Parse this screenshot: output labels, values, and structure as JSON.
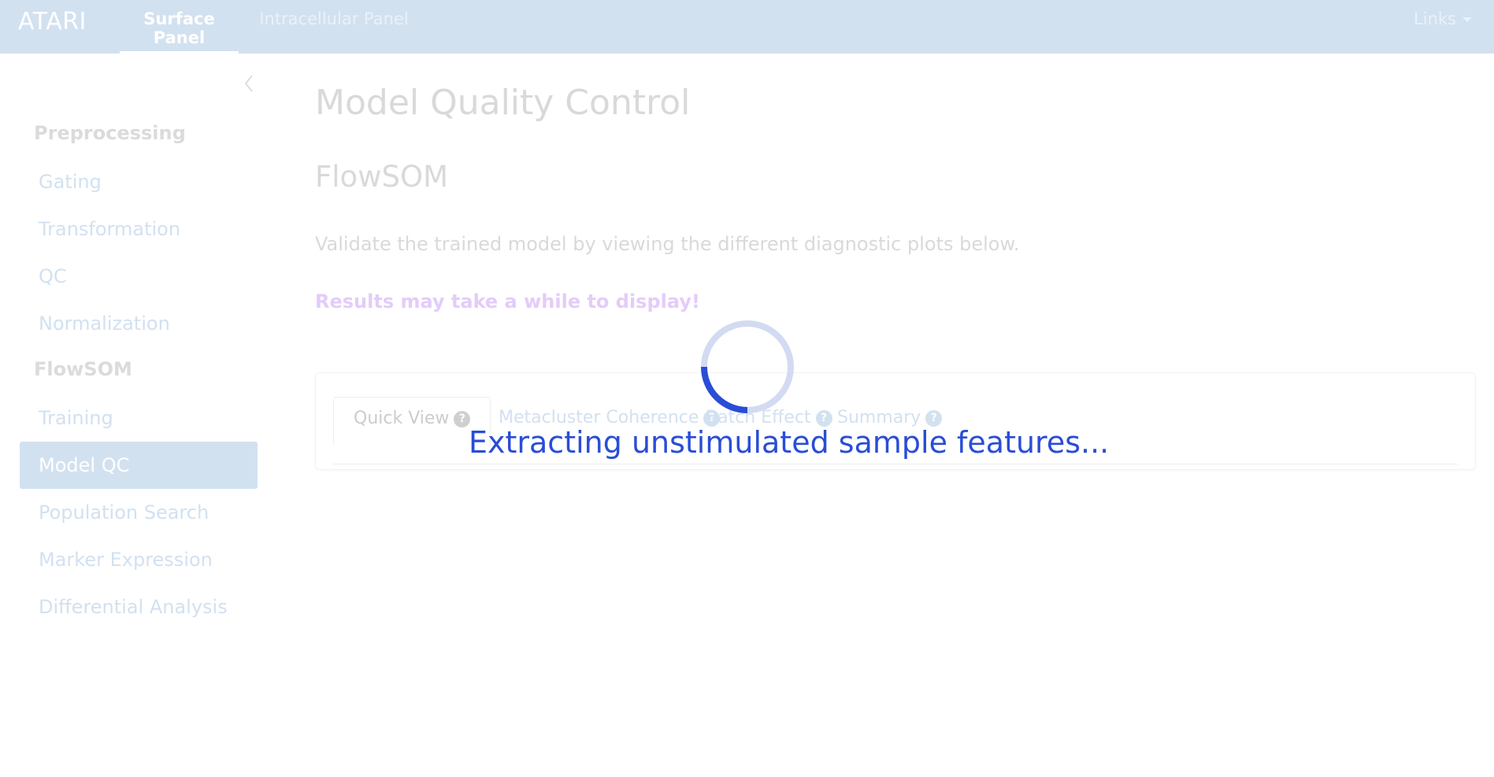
{
  "navbar": {
    "brand": "ATARI",
    "tabs": [
      {
        "label": "Surface Panel",
        "active": true
      },
      {
        "label": "Intracellular Panel",
        "active": false
      }
    ],
    "links_label": "Links"
  },
  "sidebar": {
    "sections": [
      {
        "heading": "Preprocessing",
        "items": [
          "Gating",
          "Transformation",
          "QC",
          "Normalization"
        ]
      },
      {
        "heading": "FlowSOM",
        "items": [
          "Training",
          "Model QC",
          "Population Search",
          "Marker Expression",
          "Differential Analysis"
        ]
      }
    ],
    "active_item": "Model QC"
  },
  "main": {
    "title": "Model Quality Control",
    "subtitle": "FlowSOM",
    "description": "Validate the trained model by viewing the different diagnostic plots below.",
    "warning": "Results may take a while to display!",
    "tabs": [
      {
        "label": "Quick View",
        "active": true
      },
      {
        "label": "Metacluster Coherence",
        "active": false
      },
      {
        "label": "Batch Effect",
        "active": false
      },
      {
        "label": "Summary",
        "active": false
      }
    ],
    "help_glyph": "?"
  },
  "loading": {
    "message": "Extracting unstimulated sample features..."
  },
  "colors": {
    "navbar_bg": "#d2e1f0",
    "spinner_active": "#2a4dd6",
    "spinner_track": "#d3dbf3",
    "warning": "#e3ccf9"
  },
  "icons": {
    "collapse": "chevron-left-icon",
    "dropdown": "caret-down-icon",
    "help": "question-circle-icon",
    "spinner": "spinner-icon"
  }
}
